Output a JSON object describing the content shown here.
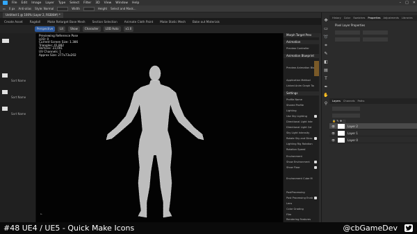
{
  "photoshop": {
    "menu": [
      "File",
      "Edit",
      "Image",
      "Layer",
      "Type",
      "Select",
      "Filter",
      "3D",
      "View",
      "Window",
      "Help"
    ],
    "window_controls": [
      "–",
      "□",
      "✕"
    ],
    "options": {
      "feather": "0 px",
      "anti_alias": "Anti-alias",
      "style": "Style: Normal",
      "width_label": "Width",
      "height_label": "Height",
      "select_mask": "Select and Mask..."
    },
    "doc_tab": "Untitled-1 @ 100% (Layer 2, RGB/8#) *",
    "panel_tabs_top": [
      "History",
      "Color",
      "Swatches",
      "Properties",
      "Adjustments",
      "Libraries"
    ],
    "properties_title": "Pixel Layer Properties",
    "layer_tabs": [
      "Layers",
      "Channels",
      "Paths"
    ],
    "layers": [
      {
        "name": "Layer 2",
        "selected": true
      },
      {
        "name": "Layer 1",
        "selected": false
      },
      {
        "name": "Layer 0",
        "selected": false
      }
    ],
    "colors": {
      "accent": "#31a8ff",
      "bg": "#2b2b2b"
    }
  },
  "ue": {
    "tabs": [
      "Create Asset",
      "Ragdoll",
      "Make Retarget Base Mesh",
      "Section Selection",
      "Animate Cloth Paint",
      "Make Static Mesh",
      "Bake out Materials"
    ],
    "toolbar": [
      "Perspective",
      "Lit",
      "Show",
      "Character",
      "LOD Auto",
      "x1.0"
    ],
    "viewport_stats": [
      "Previewing Reference Pose",
      "LOD: 0",
      "Current Screen Size: 1.386",
      "Triangles: 41,882",
      "Vertices: 23,091",
      "UV Channels: 1",
      "Approx Size: 277x73x202"
    ],
    "left_panel": {
      "items": [
        "Sort Name",
        "Sort Name",
        "Sort Name"
      ]
    },
    "right_panel": {
      "header": "Morph Target Prev",
      "sections": [
        "Animation",
        "Animation Blueprint",
        "Settings",
        "Lighting",
        "PostProcessing"
      ],
      "rows": [
        "Preview Controller",
        "Preview Animation Blu",
        "Application Method",
        "Linked Anim Graph Tag",
        "Profile Name",
        "Shared Profile",
        "Use Sky Lighting",
        "Directional Light Inte",
        "Directional Light Col",
        "Sky Light Intensity",
        "Rotate Sky and Direc",
        "Lighting Rig Rotation",
        "Rotation Speed",
        "Environment",
        "Show Environment",
        "Show Floor",
        "Environment Cube M",
        "Post Processing Enab",
        "Lens",
        "Color Grading",
        "Film",
        "Rendering Features"
      ]
    }
  },
  "caption": {
    "left": "#48 UE4 / UE5 - Quick Make Icons",
    "right": "@cbGameDev"
  }
}
